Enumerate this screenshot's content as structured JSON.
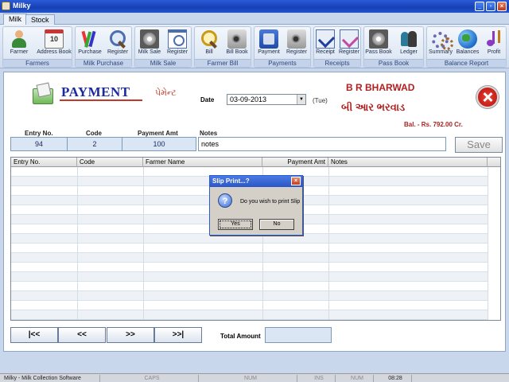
{
  "window": {
    "title": "Milky",
    "minimize": "_",
    "maximize": "▫",
    "close": "×"
  },
  "tabs": [
    "Milk",
    "Stock"
  ],
  "ribbon": {
    "groups": [
      {
        "label": "Farmers",
        "buttons": [
          {
            "label": "Farmer",
            "icon": "farmer-icon"
          },
          {
            "label": "Address Book",
            "icon": "calendar-icon",
            "badge": "10"
          }
        ]
      },
      {
        "label": "Milk Purchase",
        "buttons": [
          {
            "label": "Purchase",
            "icon": "pencils-icon"
          },
          {
            "label": "Register",
            "icon": "magnifier-icon"
          }
        ]
      },
      {
        "label": "Milk Sale",
        "buttons": [
          {
            "label": "Milk Sale",
            "icon": "film-reel-icon"
          },
          {
            "label": "Register",
            "icon": "window-search-icon"
          }
        ]
      },
      {
        "label": "Farmer Bill",
        "buttons": [
          {
            "label": "Bill",
            "icon": "magnifier-icon"
          },
          {
            "label": "Bill Book",
            "icon": "camera-icon"
          }
        ]
      },
      {
        "label": "Payments",
        "buttons": [
          {
            "label": "Payment",
            "icon": "payment-icon"
          },
          {
            "label": "Register",
            "icon": "camera-icon"
          }
        ]
      },
      {
        "label": "Receipts",
        "buttons": [
          {
            "label": "Receipt",
            "icon": "receipt-icon"
          },
          {
            "label": "Register",
            "icon": "receipt-icon"
          }
        ]
      },
      {
        "label": "Pass Book",
        "buttons": [
          {
            "label": "Pass Book",
            "icon": "film-reel-icon"
          },
          {
            "label": "Ledger",
            "icon": "people-icon"
          }
        ]
      },
      {
        "label": "Balance Report",
        "buttons": [
          {
            "label": "Summary",
            "icon": "gears-icon"
          },
          {
            "label": "Balances",
            "icon": "globe-icon"
          },
          {
            "label": "Profit",
            "icon": "music-icon"
          }
        ]
      }
    ]
  },
  "form": {
    "title": "PAYMENT",
    "title_gujarati": "પેમેન્ટ",
    "date_label": "Date",
    "date_value": "03-09-2013",
    "day": "(Tue)",
    "owner_name": "B R BHARWAD",
    "owner_name_gujarati": "બી આર ભરવાડ",
    "balance": "Bal. - Rs. 792.00 Cr.",
    "labels": {
      "entry_no": "Entry No.",
      "code": "Code",
      "payment_amt": "Payment Amt",
      "notes": "Notes"
    },
    "values": {
      "entry_no": "94",
      "code": "2",
      "payment_amt": "100",
      "notes": "notes"
    },
    "save_label": "Save"
  },
  "grid": {
    "columns": [
      "Entry No.",
      "Code",
      "Farmer Name",
      "Payment Amt",
      "Notes"
    ],
    "rows": []
  },
  "navigation": {
    "first": "|<<",
    "prev": "<<",
    "next": ">>",
    "last": ">>|"
  },
  "total": {
    "label": "Total Amount",
    "value": ""
  },
  "dialog": {
    "title": "Slip Print...?",
    "message": "Do you wish to print Slip",
    "yes": "Yes",
    "no": "No",
    "close": "×"
  },
  "statusbar": {
    "app": "Milky - Milk Collection Software",
    "caps": "CAPS",
    "num": "NUM",
    "ins": "INS",
    "num2": "NUM",
    "time": "08:28"
  }
}
